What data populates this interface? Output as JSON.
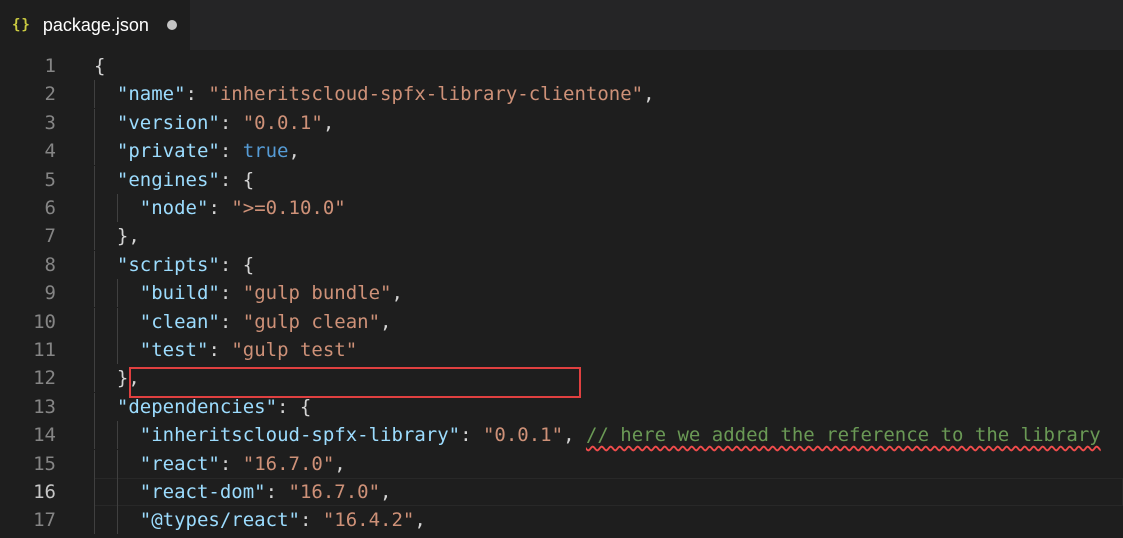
{
  "tab": {
    "icon": "json-braces-icon",
    "icon_text": "{}",
    "title": "package.json",
    "unsaved_indicator": "dirty-dot"
  },
  "editor": {
    "lines": [
      {
        "number": "1",
        "indent": 0,
        "tokens": [
          {
            "t": "{",
            "c": "punc"
          }
        ]
      },
      {
        "number": "2",
        "indent": 1,
        "tokens": [
          {
            "t": "\"name\"",
            "c": "key"
          },
          {
            "t": ": ",
            "c": "punc"
          },
          {
            "t": "\"inheritscloud-spfx-library-clientone\"",
            "c": "str"
          },
          {
            "t": ",",
            "c": "punc"
          }
        ]
      },
      {
        "number": "3",
        "indent": 1,
        "tokens": [
          {
            "t": "\"version\"",
            "c": "key"
          },
          {
            "t": ": ",
            "c": "punc"
          },
          {
            "t": "\"0.0.1\"",
            "c": "str"
          },
          {
            "t": ",",
            "c": "punc"
          }
        ]
      },
      {
        "number": "4",
        "indent": 1,
        "tokens": [
          {
            "t": "\"private\"",
            "c": "key"
          },
          {
            "t": ": ",
            "c": "punc"
          },
          {
            "t": "true",
            "c": "bool"
          },
          {
            "t": ",",
            "c": "punc"
          }
        ]
      },
      {
        "number": "5",
        "indent": 1,
        "tokens": [
          {
            "t": "\"engines\"",
            "c": "key"
          },
          {
            "t": ": {",
            "c": "punc"
          }
        ]
      },
      {
        "number": "6",
        "indent": 2,
        "tokens": [
          {
            "t": "\"node\"",
            "c": "key"
          },
          {
            "t": ": ",
            "c": "punc"
          },
          {
            "t": "\">=0.10.0\"",
            "c": "str"
          }
        ]
      },
      {
        "number": "7",
        "indent": 1,
        "tokens": [
          {
            "t": "},",
            "c": "punc"
          }
        ]
      },
      {
        "number": "8",
        "indent": 1,
        "tokens": [
          {
            "t": "\"scripts\"",
            "c": "key"
          },
          {
            "t": ": {",
            "c": "punc"
          }
        ]
      },
      {
        "number": "9",
        "indent": 2,
        "tokens": [
          {
            "t": "\"build\"",
            "c": "key"
          },
          {
            "t": ": ",
            "c": "punc"
          },
          {
            "t": "\"gulp bundle\"",
            "c": "str"
          },
          {
            "t": ",",
            "c": "punc"
          }
        ]
      },
      {
        "number": "10",
        "indent": 2,
        "tokens": [
          {
            "t": "\"clean\"",
            "c": "key"
          },
          {
            "t": ": ",
            "c": "punc"
          },
          {
            "t": "\"gulp clean\"",
            "c": "str"
          },
          {
            "t": ",",
            "c": "punc"
          }
        ]
      },
      {
        "number": "11",
        "indent": 2,
        "tokens": [
          {
            "t": "\"test\"",
            "c": "key"
          },
          {
            "t": ": ",
            "c": "punc"
          },
          {
            "t": "\"gulp test\"",
            "c": "str"
          }
        ]
      },
      {
        "number": "12",
        "indent": 1,
        "tokens": [
          {
            "t": "},",
            "c": "punc"
          }
        ]
      },
      {
        "number": "13",
        "indent": 1,
        "tokens": [
          {
            "t": "\"dependencies\"",
            "c": "key"
          },
          {
            "t": ": {",
            "c": "punc"
          }
        ]
      },
      {
        "number": "14",
        "indent": 2,
        "tokens": [
          {
            "t": "\"inheritscloud-spfx-library\"",
            "c": "key"
          },
          {
            "t": ": ",
            "c": "punc"
          },
          {
            "t": "\"0.0.1\"",
            "c": "str"
          },
          {
            "t": ", ",
            "c": "punc"
          },
          {
            "t": "// here we added the reference to the library",
            "c": "cmt"
          }
        ]
      },
      {
        "number": "15",
        "indent": 2,
        "tokens": [
          {
            "t": "\"react\"",
            "c": "key"
          },
          {
            "t": ": ",
            "c": "punc"
          },
          {
            "t": "\"16.7.0\"",
            "c": "str"
          },
          {
            "t": ",",
            "c": "punc"
          }
        ]
      },
      {
        "number": "16",
        "indent": 2,
        "current": true,
        "tokens": [
          {
            "t": "\"react-dom\"",
            "c": "key"
          },
          {
            "t": ": ",
            "c": "punc"
          },
          {
            "t": "\"16.7.0\"",
            "c": "str"
          },
          {
            "t": ",",
            "c": "punc"
          }
        ]
      },
      {
        "number": "17",
        "indent": 2,
        "tokens": [
          {
            "t": "\"@types/react\"",
            "c": "key"
          },
          {
            "t": ": ",
            "c": "punc"
          },
          {
            "t": "\"16.4.2\"",
            "c": "str"
          },
          {
            "t": ",",
            "c": "punc"
          }
        ]
      }
    ]
  },
  "annotation": {
    "highlighted_line": "14",
    "box_color": "#e04040"
  },
  "colors": {
    "background": "#1e1e1e",
    "key": "#9cdcfe",
    "string": "#ce9178",
    "boolean": "#569cd6",
    "comment": "#6a9955",
    "line_number": "#858585"
  }
}
